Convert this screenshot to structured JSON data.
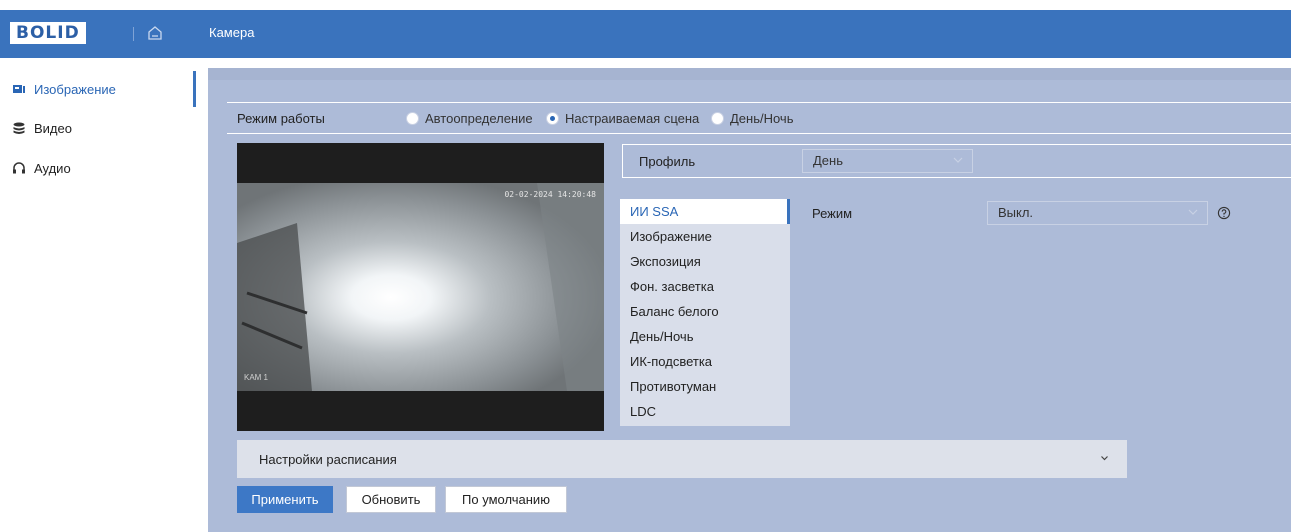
{
  "header": {
    "logo_text": "BOLID",
    "title": "Камера",
    "bg_color": "#3a73bd"
  },
  "sidebar": {
    "items": [
      {
        "label": "Изображение",
        "icon": "image-icon",
        "active": true
      },
      {
        "label": "Видео",
        "icon": "video-stack-icon",
        "active": false
      },
      {
        "label": "Аудио",
        "icon": "headphones-icon",
        "active": false
      }
    ]
  },
  "mode": {
    "label": "Режим работы",
    "options": [
      {
        "label": "Автоопределение",
        "selected": false
      },
      {
        "label": "Настраиваемая сцена",
        "selected": true
      },
      {
        "label": "День/Ночь",
        "selected": false
      }
    ]
  },
  "video": {
    "timestamp": "02-02-2024 14:20:48",
    "camera_name": "KAM 1"
  },
  "profile": {
    "label": "Профиль",
    "value": "День"
  },
  "menu": {
    "items": [
      {
        "label": "ИИ SSA",
        "active": true
      },
      {
        "label": "Изображение",
        "active": false
      },
      {
        "label": "Экспозиция",
        "active": false
      },
      {
        "label": "Фон. засветка",
        "active": false
      },
      {
        "label": "Баланс белого",
        "active": false
      },
      {
        "label": "День/Ночь",
        "active": false
      },
      {
        "label": "ИК-подсветка",
        "active": false
      },
      {
        "label": "Противотуман",
        "active": false
      },
      {
        "label": "LDC",
        "active": false
      }
    ]
  },
  "settings": {
    "mode_label": "Режим",
    "mode_value": "Выкл."
  },
  "schedule": {
    "label": "Настройки расписания"
  },
  "buttons": {
    "apply": "Применить",
    "refresh": "Обновить",
    "default": "По умолчанию"
  },
  "colors": {
    "accent": "#3a73bd",
    "panel": "#adbbd8",
    "primary_button": "#3d78c6"
  }
}
